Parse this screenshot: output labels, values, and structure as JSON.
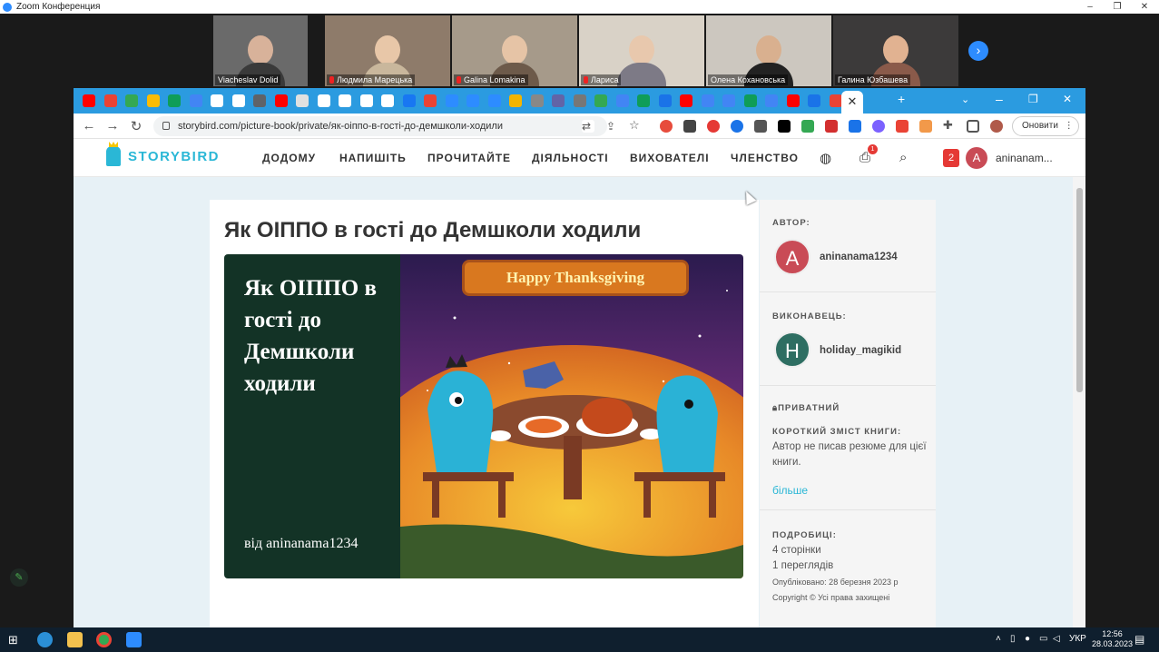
{
  "zoom": {
    "window_title": "Zoom Конференция",
    "participants": [
      {
        "name": "Viacheslav Dolid",
        "muted": false,
        "bg": "#6a6a6a",
        "skin": "#d8b29a",
        "shirt": "#3a3a3a"
      },
      {
        "name": "Людмила Марецька",
        "muted": true,
        "bg": "#8e7b6a",
        "skin": "#e8c7a8",
        "shirt": "#c9b79c"
      },
      {
        "name": "Galina Lomakina",
        "muted": true,
        "bg": "#a69a8a",
        "skin": "#e6c4a6",
        "shirt": "#6d5a4a"
      },
      {
        "name": "Лариса",
        "muted": true,
        "bg": "#d9d2c7",
        "skin": "#e8c8ad",
        "shirt": "#7d7a86"
      },
      {
        "name": "Олена Кохановська",
        "muted": false,
        "bg": "#ccc7bf",
        "skin": "#d9b08f",
        "shirt": "#222222"
      },
      {
        "name": "Галина Юзбашева",
        "muted": false,
        "bg": "#3c3a3a",
        "skin": "#e1b291",
        "shirt": "#8a5a4a"
      }
    ]
  },
  "browser": {
    "url": "storybird.com/picture-book/private/як-оіппо-в-гості-до-демшколи-ходили",
    "update_label": "Оновити",
    "favicon_colors": [
      "#ff0000",
      "#ea4335",
      "#34a853",
      "#fbbc04",
      "#0f9d58",
      "#4285f4",
      "#ffffff",
      "#ffffff",
      "#5f6368",
      "#ff0000",
      "#e0e0e0",
      "#ffffff",
      "#ffffff",
      "#ffffff",
      "#ffffff",
      "#1877f2",
      "#ea4335",
      "#2d8cff",
      "#2d8cff",
      "#2d8cff",
      "#f4b400",
      "#888888",
      "#6264a7",
      "#777777",
      "#34a853",
      "#4285f4",
      "#0f9d58",
      "#1a73e8",
      "#ff0000",
      "#4285f4",
      "#4285f4",
      "#0f9d58",
      "#4285f4",
      "#ff0000",
      "#1a73e8",
      "#ea4335"
    ]
  },
  "site": {
    "logo": "STORYBIRD",
    "menu": [
      "ДОДОМУ",
      "НАПИШІТЬ",
      "ПРОЧИТАЙТЕ",
      "ДІЯЛЬНОСТІ",
      "ВИХОВАТЕЛІ",
      "ЧЛЕНСТВО"
    ],
    "notif_count": "1",
    "msg_count": "2",
    "avatar_letter": "A",
    "username": "aninanam..."
  },
  "book": {
    "title": "Як ОІППО в гості до Демшколи ходили",
    "cover_title": "Як ОІППО в гості до Демшколи ходили",
    "cover_by": "від aninanama1234",
    "cover_sign": "Happy Thanksgiving"
  },
  "sidebar": {
    "author_label": "АВТОР:",
    "author_letter": "A",
    "author_name": "aninanama1234",
    "artist_label": "ВИКОНАВЕЦЬ:",
    "artist_letter": "H",
    "artist_name": "holiday_magikid",
    "private_label": "ПРИВАТНИЙ",
    "summary_label": "КОРОТКИЙ ЗМІСТ КНИГИ:",
    "summary_text": "Автор не писав резюме для цієї книги.",
    "more_link": "більше",
    "details_label": "ПОДРОБИЦІ:",
    "pages": "4 сторінки",
    "views": "1 переглядів",
    "published": "Опубліковано: 28 березня 2023 р",
    "copyright": "Copyright © Усі права захищені"
  },
  "taskbar": {
    "lang": "УКР",
    "time": "12:56",
    "date": "28.03.2023"
  }
}
